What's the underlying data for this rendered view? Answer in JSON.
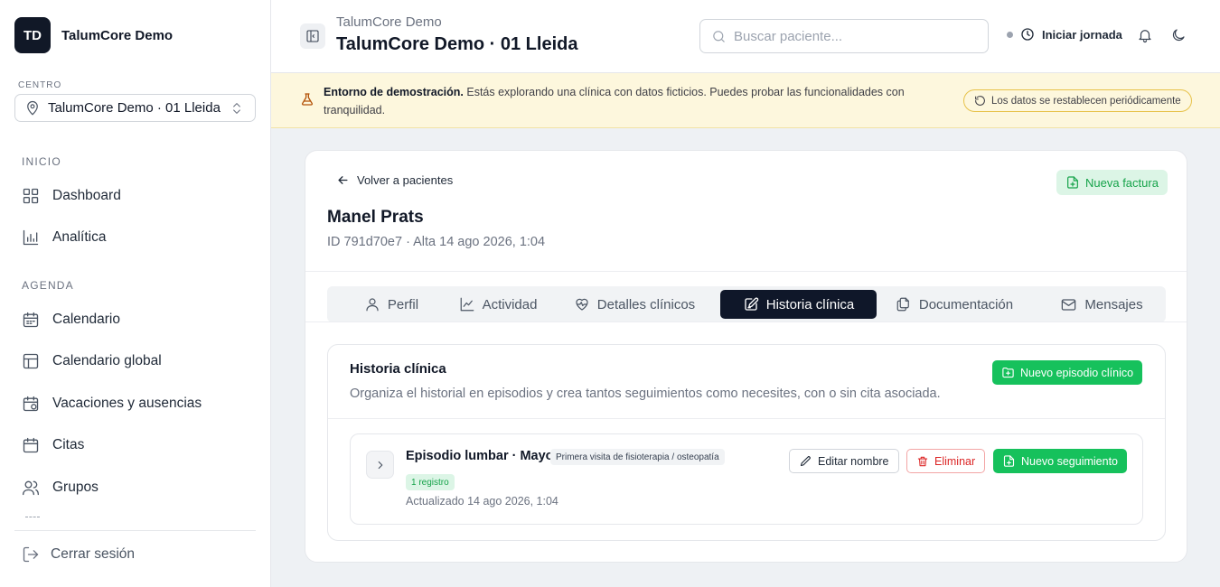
{
  "sidebar": {
    "brand_initials": "TD",
    "brand_name": "TalumCore Demo",
    "centro_label": "CENTRO",
    "centro_value": "TalumCore Demo · 01 Lleida",
    "sections": [
      {
        "label": "INICIO",
        "items": [
          {
            "label": "Dashboard",
            "icon": "dashboard-icon"
          },
          {
            "label": "Analítica",
            "icon": "chart-icon"
          }
        ]
      },
      {
        "label": "AGENDA",
        "items": [
          {
            "label": "Calendario",
            "icon": "calendar-icon"
          },
          {
            "label": "Calendario global",
            "icon": "layout-icon"
          },
          {
            "label": "Vacaciones y ausencias",
            "icon": "calendar-x-icon"
          },
          {
            "label": "Citas",
            "icon": "calendar-icon"
          },
          {
            "label": "Grupos",
            "icon": "users-icon"
          }
        ]
      }
    ],
    "logout_label": "Cerrar sesión"
  },
  "header": {
    "crumb_top": "TalumCore Demo",
    "title": "TalumCore Demo · 01 Lleida",
    "search_placeholder": "Buscar paciente...",
    "jornada_label": "Iniciar jornada"
  },
  "banner": {
    "bold": "Entorno de demostración.",
    "text": " Estás explorando una clínica con datos ficticios. Puedes probar las funcionalidades con tranquilidad.",
    "pill": "Los datos se restablecen periódicamente"
  },
  "patient": {
    "back_label": "Volver a pacientes",
    "new_invoice_label": "Nueva factura",
    "name": "Manel Prats",
    "meta": "ID 791d70e7 · Alta 14 ago 2026, 1:04"
  },
  "tabs": [
    {
      "label": "Perfil",
      "icon": "user-icon",
      "active": false
    },
    {
      "label": "Actividad",
      "icon": "activity-chart-icon",
      "active": false
    },
    {
      "label": "Detalles clínicos",
      "icon": "heart-pulse-icon",
      "active": false
    },
    {
      "label": "Historia clínica",
      "icon": "edit-note-icon",
      "active": true
    },
    {
      "label": "Documentación",
      "icon": "documents-icon",
      "active": false
    },
    {
      "label": "Mensajes",
      "icon": "mail-icon",
      "active": false
    }
  ],
  "history": {
    "title": "Historia clínica",
    "description": "Organiza el historial en episodios y crea tantos seguimientos como necesites, con o sin cita asociada.",
    "new_episode_label": "Nuevo episodio clínico",
    "episode": {
      "title": "Episodio lumbar · Mayo",
      "tag": "Primera visita de fisioterapia / osteopatía",
      "count": "1 registro",
      "updated": "Actualizado 14 ago 2026, 1:04",
      "edit_label": "Editar nombre",
      "delete_label": "Eliminar",
      "followup_label": "Nuevo seguimiento"
    }
  },
  "colors": {
    "accent_green": "#16c15c",
    "dark": "#0f1729",
    "danger": "#dc2626",
    "banner_bg": "#fdf7dd"
  }
}
